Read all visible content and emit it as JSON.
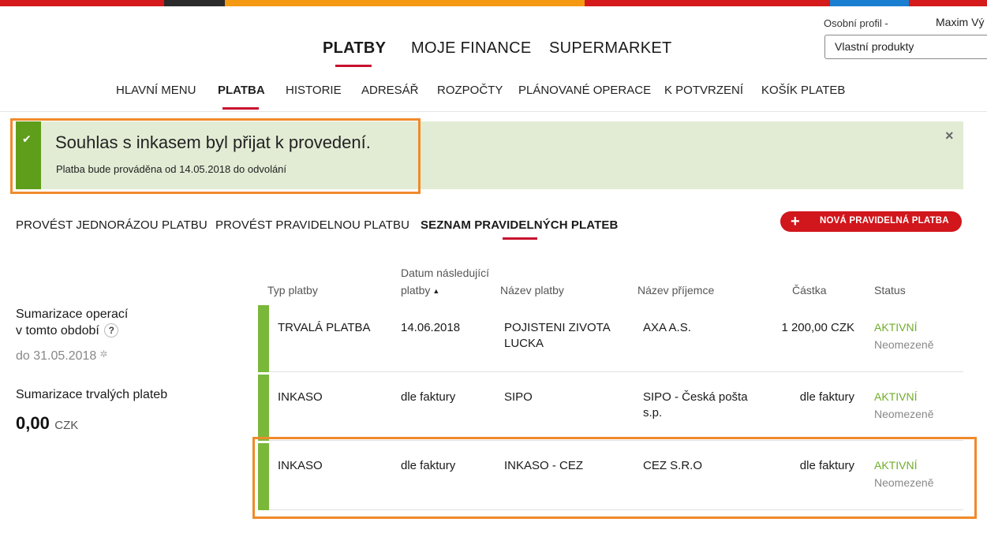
{
  "stripe_colors": [
    "#d41a1a",
    "#2b2b2b",
    "#f39a12",
    "#d41a1a",
    "#1a7fd1",
    "#d41a1a"
  ],
  "header": {
    "main_nav": [
      "PLATBY",
      "MOJE FINANCE",
      "SUPERMARKET"
    ],
    "profile_label": "Osobní profil  -",
    "user_name": "Maxim Vý",
    "profile_select": "Vlastní produkty"
  },
  "sub_nav": [
    "HLAVNÍ MENU",
    "PLATBA",
    "HISTORIE",
    "ADRESÁŘ",
    "ROZPOČTY",
    "PLÁNOVANÉ OPERACE",
    "K POTVRZENÍ",
    "KOŠÍK PLATEB"
  ],
  "alert": {
    "title": "Souhlas s inkasem byl přijat k provedení.",
    "text": "Platba bude prováděna od 14.05.2018 do odvolání",
    "close_icon": "×"
  },
  "tabs": [
    "PROVÉST JEDNORÁZOU PLATBU",
    "PROVÉST PRAVIDELNOU PLATBU",
    "SEZNAM PRAVIDELNÝCH PLATEB"
  ],
  "new_button": {
    "plus": "+",
    "label": "NOVÁ PRAVIDELNÁ PLATBA"
  },
  "summary": {
    "ops_line1": "Sumarizace operací",
    "ops_line2": "v tomto období",
    "help": "?",
    "date": "do 31.05.2018",
    "standing_title": "Sumarizace trvalých plateb",
    "standing_value": "0,00",
    "standing_currency": "CZK"
  },
  "table": {
    "headers": {
      "type": "Typ platby",
      "date_line1": "Datum následující",
      "date_line2": "platby",
      "name": "Název platby",
      "recipient": "Název příjemce",
      "amount": "Částka",
      "status": "Status"
    },
    "rows": [
      {
        "type": "TRVALÁ PLATBA",
        "date": "14.06.2018",
        "name1": "POJISTENI ZIVOTA",
        "name2": "LUCKA",
        "recipient1": "AXA A.S.",
        "recipient2": "",
        "amount": "1 200,00 CZK",
        "status": "AKTIVNÍ",
        "validity": "Neomezeně"
      },
      {
        "type": "INKASO",
        "date": "dle faktury",
        "name1": "SIPO",
        "name2": "",
        "recipient1": "SIPO - Česká pošta",
        "recipient2": "s.p.",
        "amount": "dle faktury",
        "status": "AKTIVNÍ",
        "validity": "Neomezeně"
      },
      {
        "type": "INKASO",
        "date": "dle faktury",
        "name1": "INKASO - CEZ",
        "name2": "",
        "recipient1": "CEZ S.R.O",
        "recipient2": "",
        "amount": "dle faktury",
        "status": "AKTIVNÍ",
        "validity": "Neomezeně"
      }
    ]
  }
}
